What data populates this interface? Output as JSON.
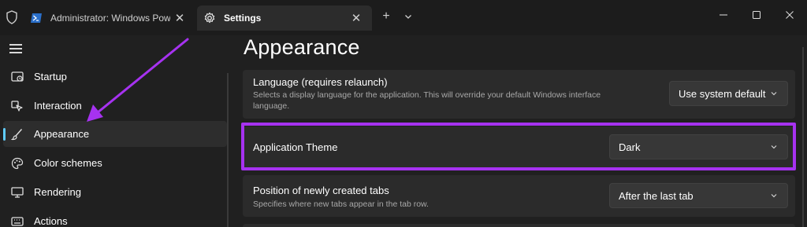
{
  "titlebar": {
    "tabs": [
      {
        "label": "Administrator: Windows Power",
        "icon": "powershell-icon",
        "close": "✕"
      },
      {
        "label": "Settings",
        "icon": "gear-icon",
        "close": "✕"
      }
    ],
    "new_tab": "+",
    "dropdown": "⌄"
  },
  "sidebar": {
    "items": [
      {
        "label": "Startup",
        "icon": "startup-icon"
      },
      {
        "label": "Interaction",
        "icon": "interaction-icon"
      },
      {
        "label": "Appearance",
        "icon": "brush-icon",
        "active": true
      },
      {
        "label": "Color schemes",
        "icon": "palette-icon"
      },
      {
        "label": "Rendering",
        "icon": "monitor-icon"
      },
      {
        "label": "Actions",
        "icon": "keyboard-icon"
      }
    ]
  },
  "main": {
    "title": "Appearance",
    "settings": [
      {
        "title": "Language (requires relaunch)",
        "description": "Selects a display language for the application. This will override your default Windows interface language.",
        "value": "Use system default"
      },
      {
        "title": "Application Theme",
        "value": "Dark"
      },
      {
        "title": "Position of newly created tabs",
        "description": "Specifies where new tabs appear in the tab row.",
        "value": "After the last tab"
      }
    ]
  },
  "colors": {
    "highlight": "#a632f0",
    "accent": "#60cdff",
    "background": "#202020",
    "card": "#2b2b2b"
  }
}
